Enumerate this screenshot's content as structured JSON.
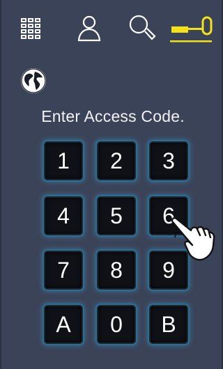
{
  "toolbar": {
    "icons": [
      {
        "name": "grid-menu-icon",
        "color": "#ffffff"
      },
      {
        "name": "user-icon",
        "color": "#ffffff"
      },
      {
        "name": "search-icon",
        "color": "#ffffff"
      },
      {
        "name": "key-icon",
        "color": "#f4e11b",
        "active": true
      }
    ]
  },
  "language": {
    "icon": "globe-icon"
  },
  "prompt": "Enter Access Code.",
  "keypad": {
    "keys": [
      "1",
      "2",
      "3",
      "4",
      "5",
      "6",
      "7",
      "8",
      "9",
      "A",
      "0",
      "B"
    ],
    "pressed_key": "6"
  },
  "colors": {
    "background": "#3b4358",
    "key_face": "#0f1116",
    "key_glow": "#3ea0d2",
    "accent": "#f4e11b"
  }
}
